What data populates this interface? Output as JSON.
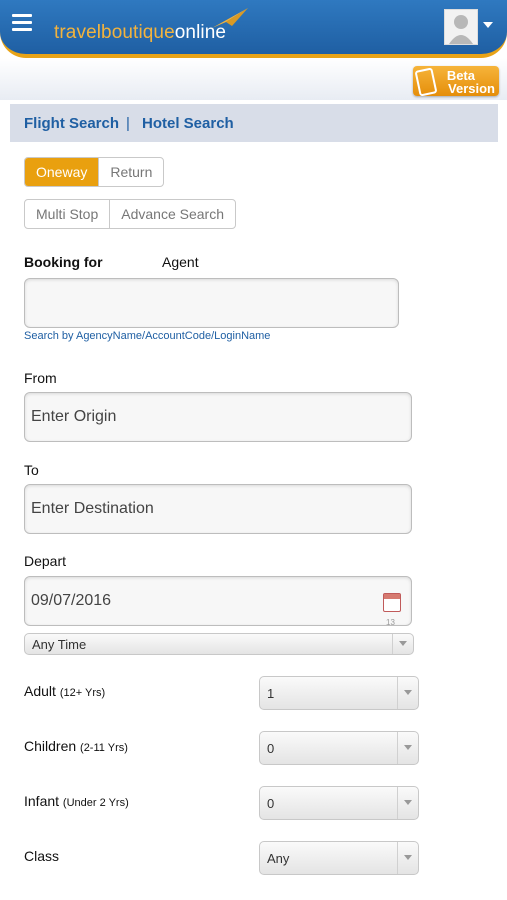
{
  "header": {
    "logo_part1": "travelboutique",
    "logo_part2": "online",
    "beta_line1": "Beta",
    "beta_line2": "Version",
    "brand_accent": "#e8a317",
    "brand_blue": "#1f5fa3"
  },
  "tabs": {
    "flight": "Flight Search",
    "separator": "|",
    "hotel": "Hotel Search"
  },
  "trip_type": {
    "oneway": "Oneway",
    "return": "Return",
    "selected": "Oneway"
  },
  "search_mode": {
    "multi_stop": "Multi Stop",
    "advance": "Advance Search"
  },
  "booking": {
    "label": "Booking for",
    "agent": "Agent",
    "value": "",
    "hint": "Search by AgencyName/AccountCode/LoginName"
  },
  "from": {
    "label": "From",
    "placeholder": "Enter Origin"
  },
  "to": {
    "label": "To",
    "placeholder": "Enter Destination"
  },
  "depart": {
    "label": "Depart",
    "date": "09/07/2016",
    "time": "Any Time"
  },
  "passengers": {
    "adult": {
      "label": "Adult",
      "range": "(12+ Yrs)",
      "value": "1"
    },
    "children": {
      "label": "Children",
      "range": "(2-11 Yrs)",
      "value": "0"
    },
    "infant": {
      "label": "Infant",
      "range": "(Under 2 Yrs)",
      "value": "0"
    }
  },
  "class": {
    "label": "Class",
    "value": "Any"
  },
  "icons": [
    "menu-icon",
    "paper-plane-icon",
    "user-avatar-icon",
    "mobile-phone-icon",
    "calendar-icon"
  ]
}
